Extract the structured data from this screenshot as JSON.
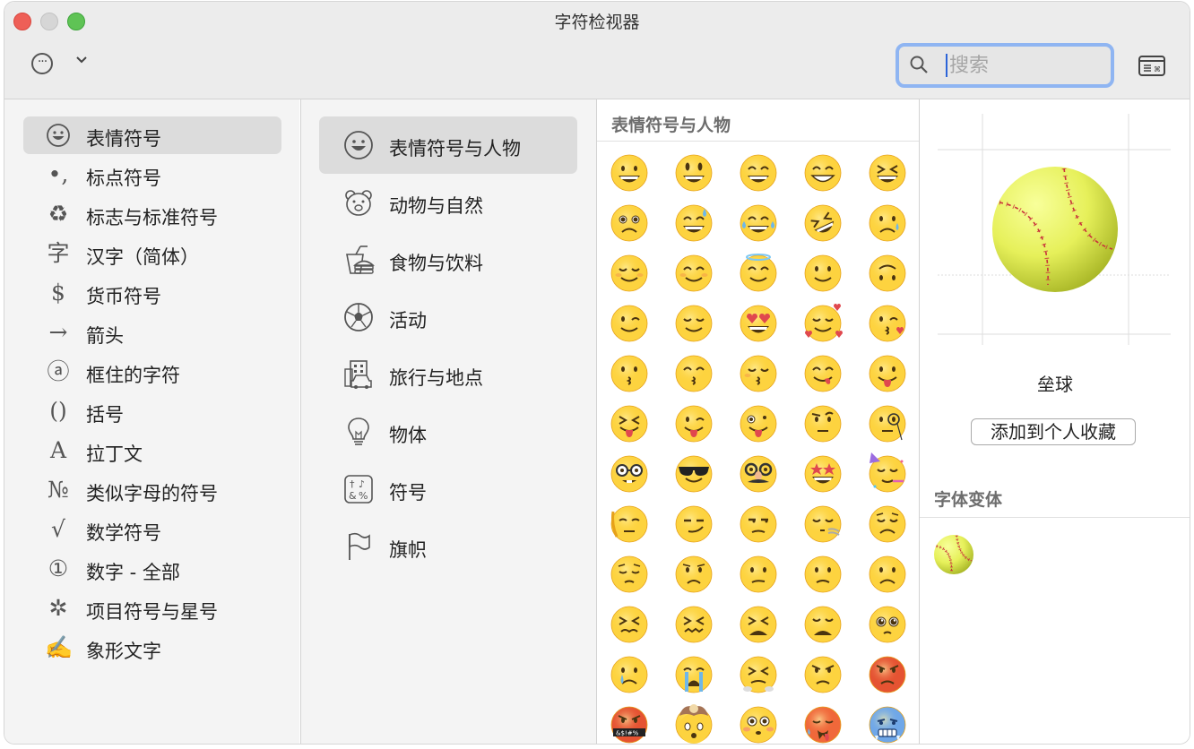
{
  "window": {
    "title": "字符检视器"
  },
  "toolbar": {
    "more_label": "···",
    "chevron_label": "⌄"
  },
  "search": {
    "placeholder": "搜索",
    "value": ""
  },
  "categories": [
    {
      "label": "表情符号",
      "icon": "smiley-icon",
      "glyph": "",
      "selected": true
    },
    {
      "label": "标点符号",
      "icon": "punctuation-icon",
      "glyph": "•,",
      "selected": false
    },
    {
      "label": "标志与标准符号",
      "icon": "recycle-icon",
      "glyph": "♻",
      "selected": false
    },
    {
      "label": "汉字（简体）",
      "icon": "hanzi-icon",
      "glyph": "字",
      "selected": false
    },
    {
      "label": "货币符号",
      "icon": "dollar-icon",
      "glyph": "$",
      "selected": false
    },
    {
      "label": "箭头",
      "icon": "arrow-icon",
      "glyph": "→",
      "selected": false
    },
    {
      "label": "框住的字符",
      "icon": "circled-a-icon",
      "glyph": "ⓐ",
      "selected": false
    },
    {
      "label": "括号",
      "icon": "parentheses-icon",
      "glyph": "()",
      "selected": false
    },
    {
      "label": "拉丁文",
      "icon": "latin-a-icon",
      "glyph": "A",
      "selected": false
    },
    {
      "label": "类似字母的符号",
      "icon": "numero-icon",
      "glyph": "№",
      "selected": false
    },
    {
      "label": "数学符号",
      "icon": "sqrt-icon",
      "glyph": "√",
      "selected": false
    },
    {
      "label": "数字 - 全部",
      "icon": "circled-one-icon",
      "glyph": "①",
      "selected": false
    },
    {
      "label": "项目符号与星号",
      "icon": "asterisk-icon",
      "glyph": "✲",
      "selected": false
    },
    {
      "label": "象形文字",
      "icon": "writing-hand-icon",
      "glyph": "✍",
      "selected": false
    }
  ],
  "subcategories": [
    {
      "label": "表情符号与人物",
      "icon": "smiley-icon",
      "selected": true
    },
    {
      "label": "动物与自然",
      "icon": "bear-icon",
      "selected": false
    },
    {
      "label": "食物与饮料",
      "icon": "burger-drink-icon",
      "selected": false
    },
    {
      "label": "活动",
      "icon": "soccer-ball-icon",
      "selected": false
    },
    {
      "label": "旅行与地点",
      "icon": "building-car-icon",
      "selected": false
    },
    {
      "label": "物体",
      "icon": "lightbulb-icon",
      "selected": false
    },
    {
      "label": "符号",
      "icon": "symbols-icon",
      "selected": false
    },
    {
      "label": "旗帜",
      "icon": "flag-icon",
      "selected": false
    }
  ],
  "emoji_panel": {
    "header": "表情符号与人物",
    "rows": [
      [
        "grinning-face",
        "grinning-face-big-eyes",
        "grinning-face-smiling-eyes",
        "beaming-face",
        "grinning-squinting-face"
      ],
      [
        "face-holding-back-tears",
        "grinning-face-sweat",
        "face-tears-of-joy",
        "rolling-on-floor-laughing",
        "crying-face"
      ],
      [
        "smiling-face",
        "smiling-face-smiling-eyes",
        "smiling-face-halo",
        "slightly-smiling-face",
        "upside-down-face"
      ],
      [
        "winking-face",
        "relieved-face",
        "heart-eyes",
        "smiling-face-hearts",
        "face-blowing-kiss"
      ],
      [
        "kissing-face",
        "kissing-face-smiling-eyes",
        "kissing-face-closed-eyes",
        "face-savoring-food",
        "face-with-tongue"
      ],
      [
        "squinting-face-tongue",
        "winking-face-tongue",
        "zany-face",
        "face-raised-eyebrow",
        "face-with-monocle"
      ],
      [
        "nerd-face",
        "smiling-face-sunglasses",
        "disguised-face",
        "star-struck",
        "partying-face"
      ],
      [
        "face-peeking-hand",
        "smirking-face",
        "unamused-face",
        "face-exhaling",
        "disappointed-face"
      ],
      [
        "pensive-face",
        "worried-face",
        "confused-face",
        "slightly-frowning-face",
        "frowning-face"
      ],
      [
        "persevering-face",
        "confounded-face",
        "tired-face",
        "weary-face",
        "pleading-face"
      ],
      [
        "crying-face-tear",
        "loudly-crying-face",
        "face-steam-nose",
        "angry-face",
        "pouting-face"
      ],
      [
        "face-symbols-mouth",
        "exploding-head",
        "flushed-face",
        "hot-face",
        "cold-face"
      ]
    ]
  },
  "detail": {
    "character_name": "垒球",
    "emoji": "softball",
    "add_favorite_label": "添加到个人收藏",
    "variants_header": "字体变体"
  },
  "colors": {
    "window_bg": "#ececec",
    "sidebar_bg": "#f4f4f4",
    "selection_bg": "#dcdcdc",
    "search_focus": "#8fb5f2",
    "emoji_yellow": "#fdd33f",
    "softball_yellow": "#e6f05a",
    "stitch_red": "#c8313a"
  }
}
